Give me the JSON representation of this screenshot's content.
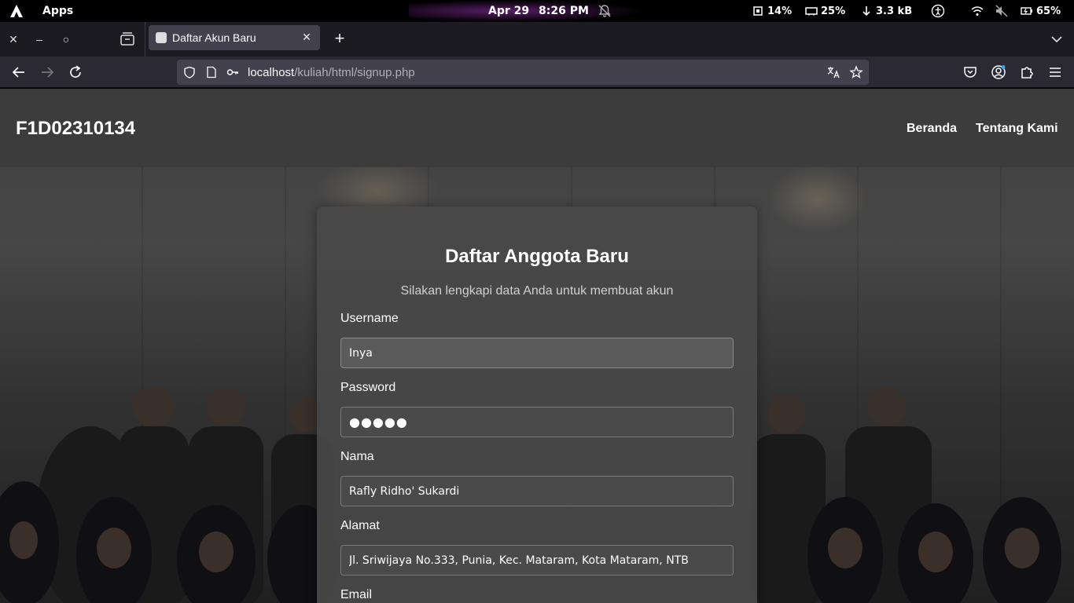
{
  "system": {
    "apps_label": "Apps",
    "date": "Apr 29",
    "time": "8:26 PM",
    "cpu": "14%",
    "memory": "25%",
    "network": "3.3 kB",
    "battery": "65%"
  },
  "browser": {
    "tab_title": "Daftar Akun Baru",
    "url_host": "localhost",
    "url_path": "/kuliah/html/signup.php"
  },
  "site": {
    "brand": "F1D02310134",
    "nav": [
      "Beranda",
      "Tentang Kami"
    ]
  },
  "form": {
    "heading": "Daftar Anggota Baru",
    "subtitle": "Silakan lengkapi data Anda untuk membuat akun",
    "username_label": "Username",
    "username_value": "Inya",
    "password_label": "Password",
    "password_value": "●●●●●",
    "nama_label": "Nama",
    "nama_value": "Rafly Ridho' Sukardi",
    "alamat_label": "Alamat",
    "alamat_value": "Jl. Sriwijaya No.333, Punia, Kec. Mataram, Kota Mataram, NTB",
    "email_label": "Email"
  }
}
